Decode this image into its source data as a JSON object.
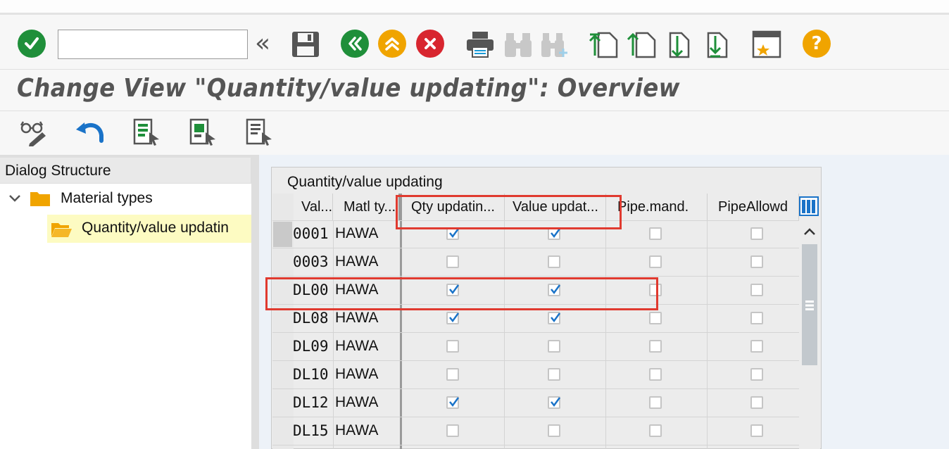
{
  "toolbar": {
    "command_field_value": "",
    "command_field_placeholder": "",
    "expand_label": "«"
  },
  "title": "Change View \"Quantity/value updating\": Overview",
  "dialog_structure": {
    "header": "Dialog Structure",
    "items": [
      {
        "label": "Material types",
        "level": 0,
        "expanded": true
      },
      {
        "label": "Quantity/value updatin",
        "level": 1,
        "selected": true
      }
    ]
  },
  "table": {
    "title": "Quantity/value updating",
    "columns": [
      "Val...",
      "Matl ty...",
      "Qty updatin...",
      "Value updat...",
      "Pipe.mand.",
      "PipeAllowd"
    ],
    "rows": [
      {
        "val": "0001",
        "matl": "HAWA",
        "qty": true,
        "value": true,
        "pipe_mand": false,
        "pipe_allowed": false
      },
      {
        "val": "0003",
        "matl": "HAWA",
        "qty": false,
        "value": false,
        "pipe_mand": false,
        "pipe_allowed": false
      },
      {
        "val": "DL00",
        "matl": "HAWA",
        "qty": true,
        "value": true,
        "pipe_mand": false,
        "pipe_allowed": false
      },
      {
        "val": "DL08",
        "matl": "HAWA",
        "qty": true,
        "value": true,
        "pipe_mand": false,
        "pipe_allowed": false
      },
      {
        "val": "DL09",
        "matl": "HAWA",
        "qty": false,
        "value": false,
        "pipe_mand": false,
        "pipe_allowed": false
      },
      {
        "val": "DL10",
        "matl": "HAWA",
        "qty": false,
        "value": false,
        "pipe_mand": false,
        "pipe_allowed": false
      },
      {
        "val": "DL12",
        "matl": "HAWA",
        "qty": true,
        "value": true,
        "pipe_mand": false,
        "pipe_allowed": false
      },
      {
        "val": "DL15",
        "matl": "HAWA",
        "qty": false,
        "value": false,
        "pipe_mand": false,
        "pipe_allowed": false
      }
    ]
  },
  "colors": {
    "accept_green": "#1f8f3a",
    "nav_green": "#1f8f3a",
    "nav_orange": "#f0a400",
    "cancel_red": "#d8262f",
    "help_orange": "#f0a400",
    "highlight_red": "#e03a2f",
    "check_blue": "#1a73c8",
    "tree_selected_bg": "#fdfbc2"
  }
}
